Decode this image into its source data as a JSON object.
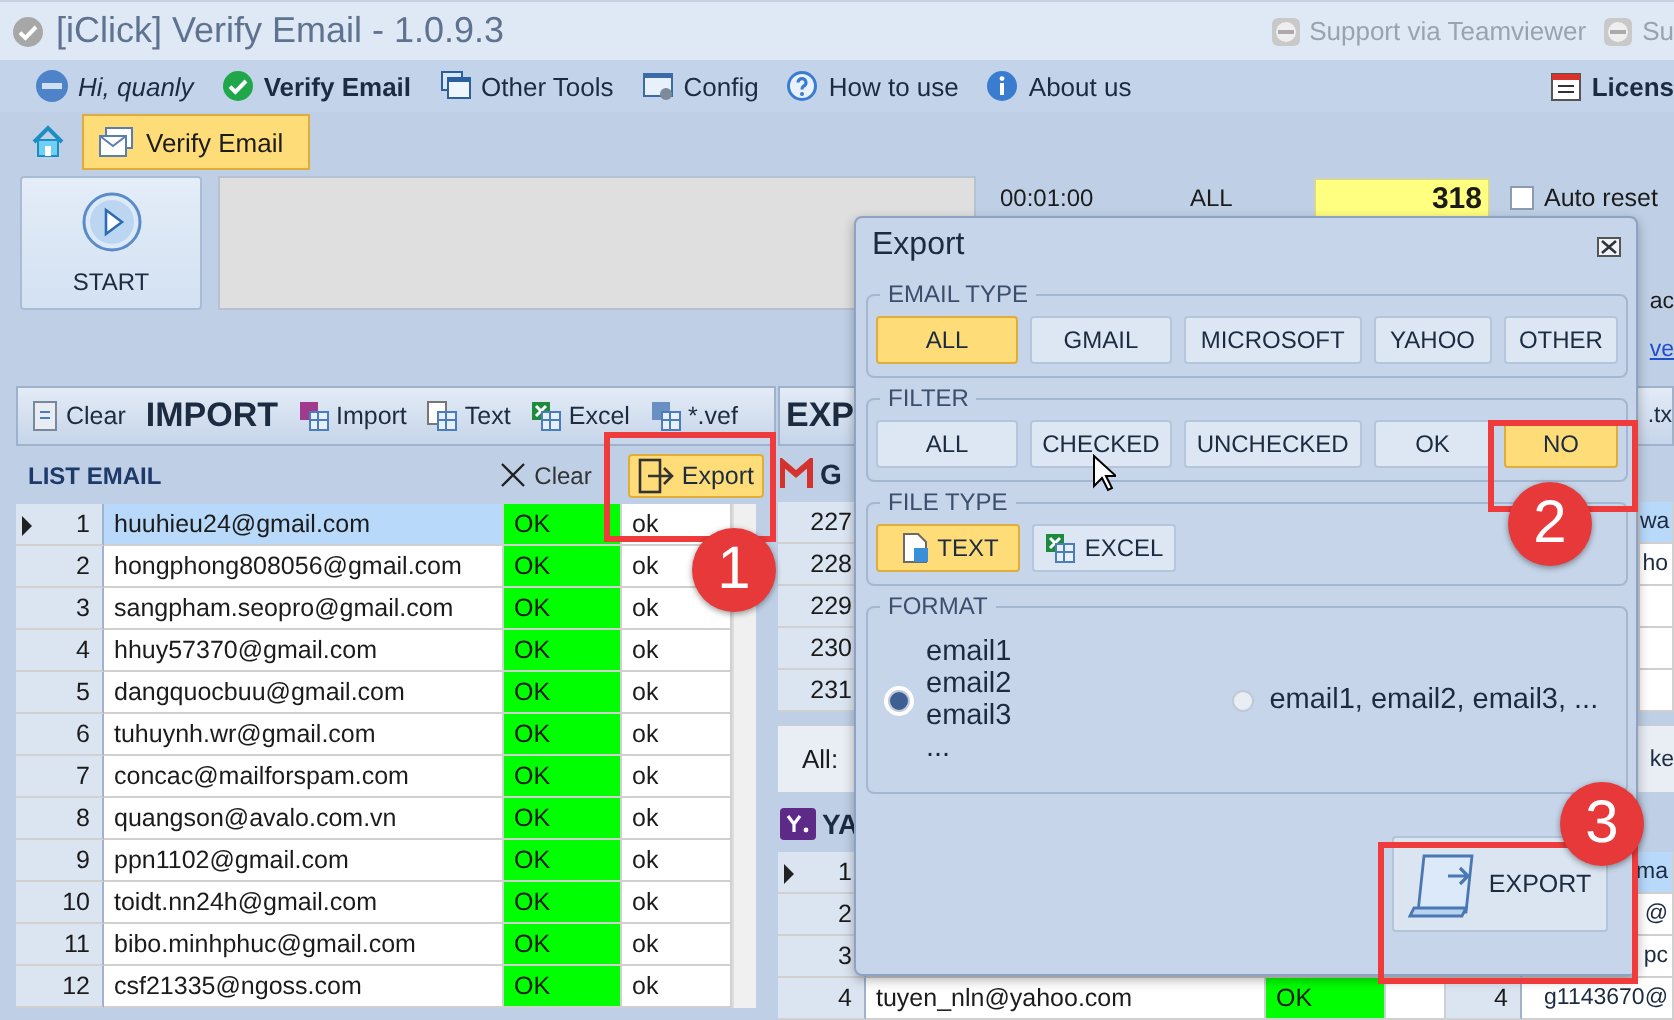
{
  "window": {
    "title": "[iClick] Verify Email - 1.0.9.3",
    "links": [
      "Support via Teamviewer",
      "Su"
    ]
  },
  "menu": {
    "greeting": "Hi, quanly",
    "items": [
      {
        "label": "Verify Email",
        "selected": true
      },
      {
        "label": "Other Tools",
        "selected": false
      },
      {
        "label": "Config",
        "selected": false
      },
      {
        "label": "How to use",
        "selected": false
      },
      {
        "label": "About us",
        "selected": false
      }
    ],
    "license": "Licens"
  },
  "tabs": [
    {
      "label": "Verify Email",
      "selected": true
    }
  ],
  "toolbar": {
    "start": "START",
    "timer": "00:01:00",
    "filter": "ALL",
    "count": "318",
    "auto_reset": {
      "label": "Auto reset",
      "checked": false
    },
    "side_texts": [
      "ac",
      "ve"
    ]
  },
  "import_panel": {
    "clear": "Clear",
    "title": "IMPORT",
    "actions": [
      "Import",
      "Text",
      "Excel",
      "*.vef"
    ],
    "list_title": "LIST EMAIL",
    "list_clear": "Clear",
    "export": "Export",
    "rows": [
      {
        "index": "1",
        "email": "huuhieu24@gmail.com",
        "status": "OK",
        "result": "ok",
        "selected": true
      },
      {
        "index": "2",
        "email": "hongphong808056@gmail.com",
        "status": "OK",
        "result": "ok",
        "selected": false
      },
      {
        "index": "3",
        "email": "sangpham.seopro@gmail.com",
        "status": "OK",
        "result": "ok",
        "selected": false
      },
      {
        "index": "4",
        "email": "hhuy57370@gmail.com",
        "status": "OK",
        "result": "ok",
        "selected": false
      },
      {
        "index": "5",
        "email": "dangquocbuu@gmail.com",
        "status": "OK",
        "result": "ok",
        "selected": false
      },
      {
        "index": "6",
        "email": "tuhuynh.wr@gmail.com",
        "status": "OK",
        "result": "ok",
        "selected": false
      },
      {
        "index": "7",
        "email": "concac@mailforspam.com",
        "status": "OK",
        "result": "ok",
        "selected": false
      },
      {
        "index": "8",
        "email": "quangson@avalo.com.vn",
        "status": "OK",
        "result": "ok",
        "selected": false
      },
      {
        "index": "9",
        "email": "ppn1102@gmail.com",
        "status": "OK",
        "result": "ok",
        "selected": false
      },
      {
        "index": "10",
        "email": "toidt.nn24h@gmail.com",
        "status": "OK",
        "result": "ok",
        "selected": false
      },
      {
        "index": "11",
        "email": "bibo.minhphuc@gmail.com",
        "status": "OK",
        "result": "ok",
        "selected": false
      },
      {
        "index": "12",
        "email": "csf21335@ngoss.com",
        "status": "OK",
        "result": "ok",
        "selected": false
      }
    ]
  },
  "export_panel": {
    "title": "EXP",
    "header_right": ".tx",
    "gmail": {
      "title": "G",
      "rows": [
        {
          "index": "227",
          "column_3": "wa",
          "selected": true
        },
        {
          "index": "228",
          "column_3": "ho",
          "selected": false
        },
        {
          "index": "229",
          "selected": false
        },
        {
          "index": "230",
          "selected": false
        },
        {
          "index": "231",
          "selected": false
        }
      ]
    },
    "status": "All:",
    "status_right": "ke",
    "yahoo": {
      "title": "YA",
      "rows": [
        {
          "index": "1",
          "column_5": "ma",
          "selected": true
        },
        {
          "index": "2",
          "column_5": "@",
          "selected": false
        },
        {
          "index": "3",
          "column_5": "pc",
          "selected": false
        },
        {
          "index": "4",
          "email": "tuyen_nln@yahoo.com",
          "status": "OK",
          "index_2": "4",
          "column_5": "g1143670@",
          "selected": false
        }
      ]
    }
  },
  "dialog": {
    "title": "Export",
    "sections": [
      {
        "title": "EMAIL TYPE",
        "kind": "buttons",
        "options": [
          {
            "label": "ALL",
            "selected": true
          },
          {
            "label": "GMAIL",
            "selected": false
          },
          {
            "label": "MICROSOFT",
            "selected": false
          },
          {
            "label": "YAHOO",
            "selected": false
          },
          {
            "label": "OTHER",
            "selected": false
          }
        ]
      },
      {
        "title": "FILTER",
        "kind": "buttons",
        "options": [
          {
            "label": "ALL",
            "selected": false
          },
          {
            "label": "CHECKED",
            "selected": false
          },
          {
            "label": "UNCHECKED",
            "selected": false
          },
          {
            "label": "OK",
            "selected": false
          },
          {
            "label": "NO",
            "selected": true
          }
        ]
      },
      {
        "title": "FILE TYPE",
        "kind": "filetypes",
        "options": [
          {
            "label": "TEXT",
            "selected": true
          },
          {
            "label": "EXCEL",
            "selected": false
          }
        ]
      },
      {
        "title": "FORMAT",
        "kind": "radios",
        "options": [
          {
            "label": "email1\nemail2\nemail3\n...",
            "selected": true
          },
          {
            "label": "email1, email2, email3, ...",
            "selected": false
          }
        ]
      }
    ],
    "button": "EXPORT"
  },
  "callouts": [
    {
      "number": "1"
    },
    {
      "number": "2"
    },
    {
      "number": "3"
    }
  ]
}
